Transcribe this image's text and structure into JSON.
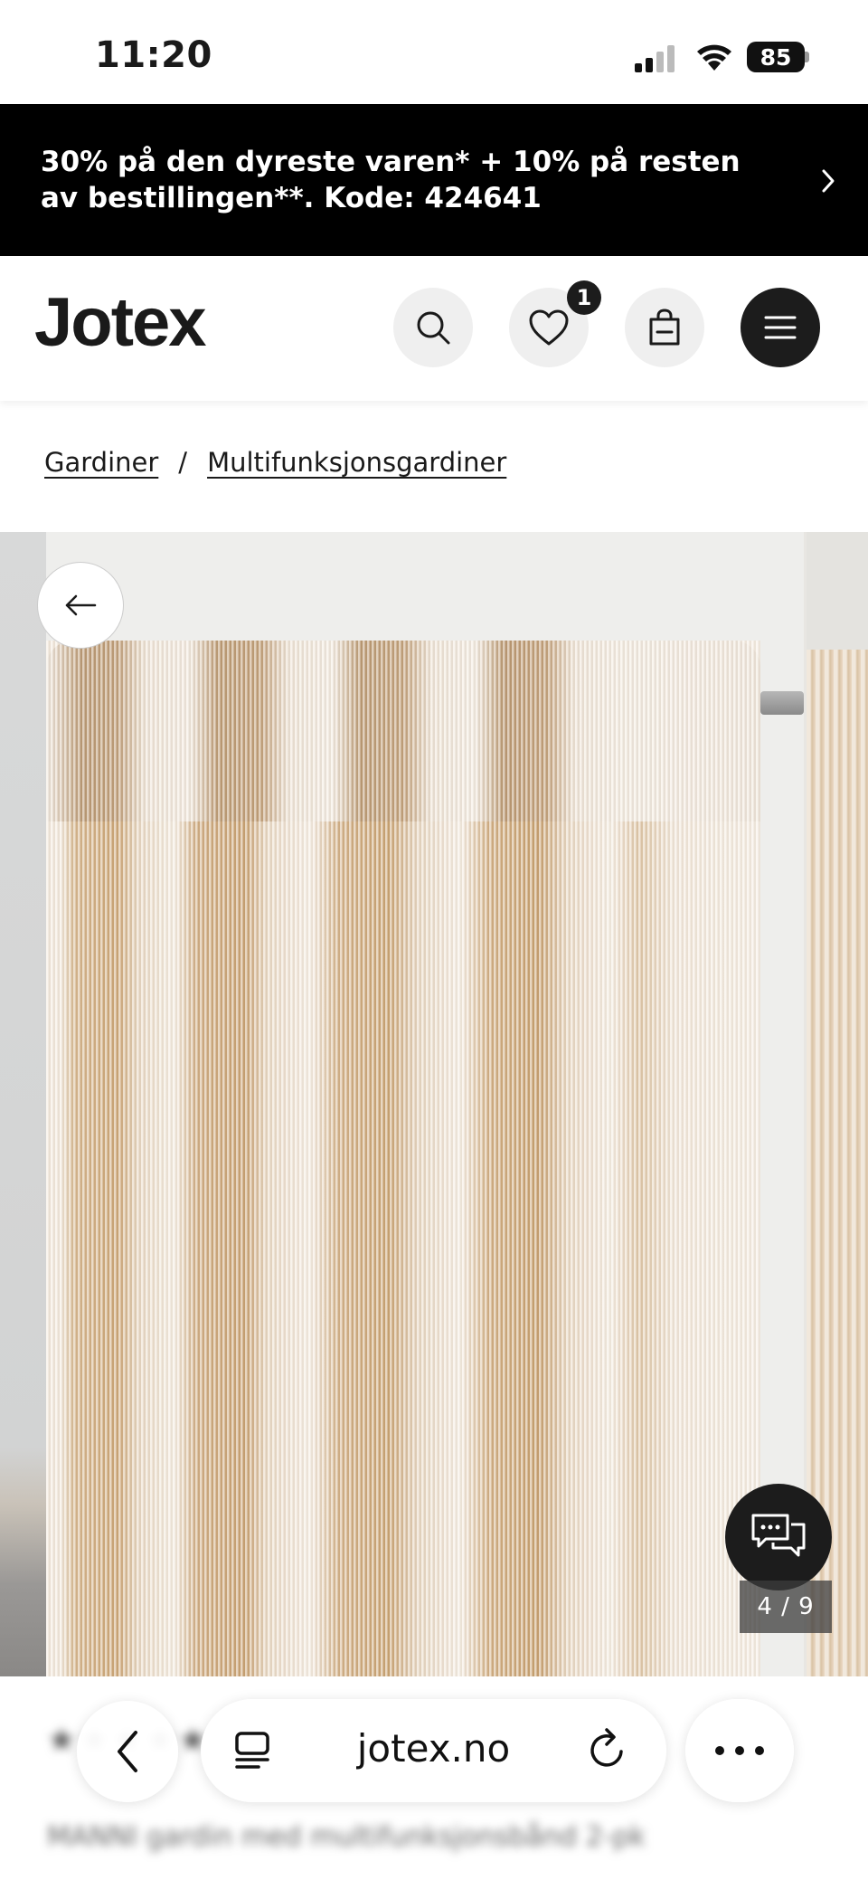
{
  "status_bar": {
    "time": "11:20",
    "battery": "85"
  },
  "promo": {
    "text": "30% på den dyreste varen* + 10% på resten av bestillingen**. Kode: 424641"
  },
  "header": {
    "logo": "Jotex",
    "wishlist_count": "1"
  },
  "breadcrumb": {
    "items": [
      "Gardiner",
      "Multifunksjonsgardiner"
    ],
    "separator": "/"
  },
  "gallery": {
    "counter": "4 / 9"
  },
  "product": {
    "rating_blurred": "★★★★★",
    "title_blurred": "MANNI gardin med multifunksjonsbånd 2-pk"
  },
  "browser": {
    "url": "jotex.no"
  },
  "colors": {
    "promo_bg": "#000000",
    "accent_dark": "#1c1c1c",
    "icon_bg": "#efefef"
  }
}
